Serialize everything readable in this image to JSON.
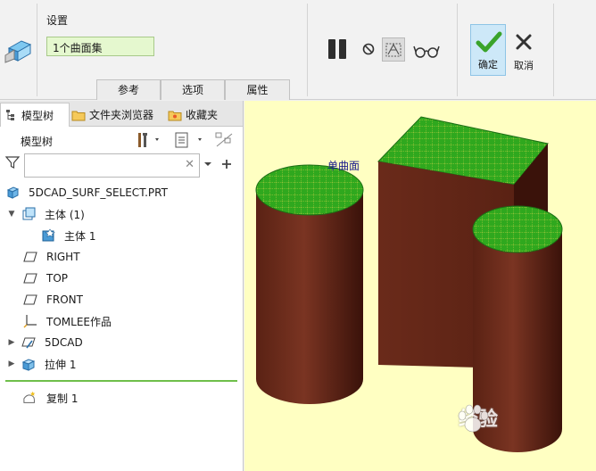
{
  "ribbon": {
    "settings_label": "设置",
    "collector_value": "1个曲面集",
    "tabs": [
      "参考",
      "选项",
      "属性"
    ],
    "ok_label": "确定",
    "cancel_label": "取消"
  },
  "panel": {
    "tabs": [
      "模型树",
      "文件夹浏览器",
      "收藏夹"
    ],
    "tree_header": "模型树",
    "search_placeholder": "",
    "tree": [
      {
        "label": "5DCAD_SURF_SELECT.PRT",
        "icon": "part-icon"
      },
      {
        "label": "主体 (1)",
        "icon": "body-folder-icon"
      },
      {
        "label": "主体 1",
        "icon": "body-icon"
      },
      {
        "label": "RIGHT",
        "icon": "datum-plane-icon"
      },
      {
        "label": "TOP",
        "icon": "datum-plane-icon"
      },
      {
        "label": "FRONT",
        "icon": "datum-plane-icon"
      },
      {
        "label": "TOMLEE作品",
        "icon": "coord-system-icon"
      },
      {
        "label": "5DCAD",
        "icon": "sketch-icon"
      },
      {
        "label": "拉伸 1",
        "icon": "extrude-icon"
      },
      {
        "label": "复制 1",
        "icon": "copy-surface-icon"
      }
    ]
  },
  "graphics": {
    "surface_label": "单曲面",
    "watermark_text": "经验",
    "colors": {
      "background": "#ffffc2",
      "solid": "#6b2a1b",
      "selected_surface": "#2fa81e",
      "mesh": "#d6d64a"
    }
  }
}
